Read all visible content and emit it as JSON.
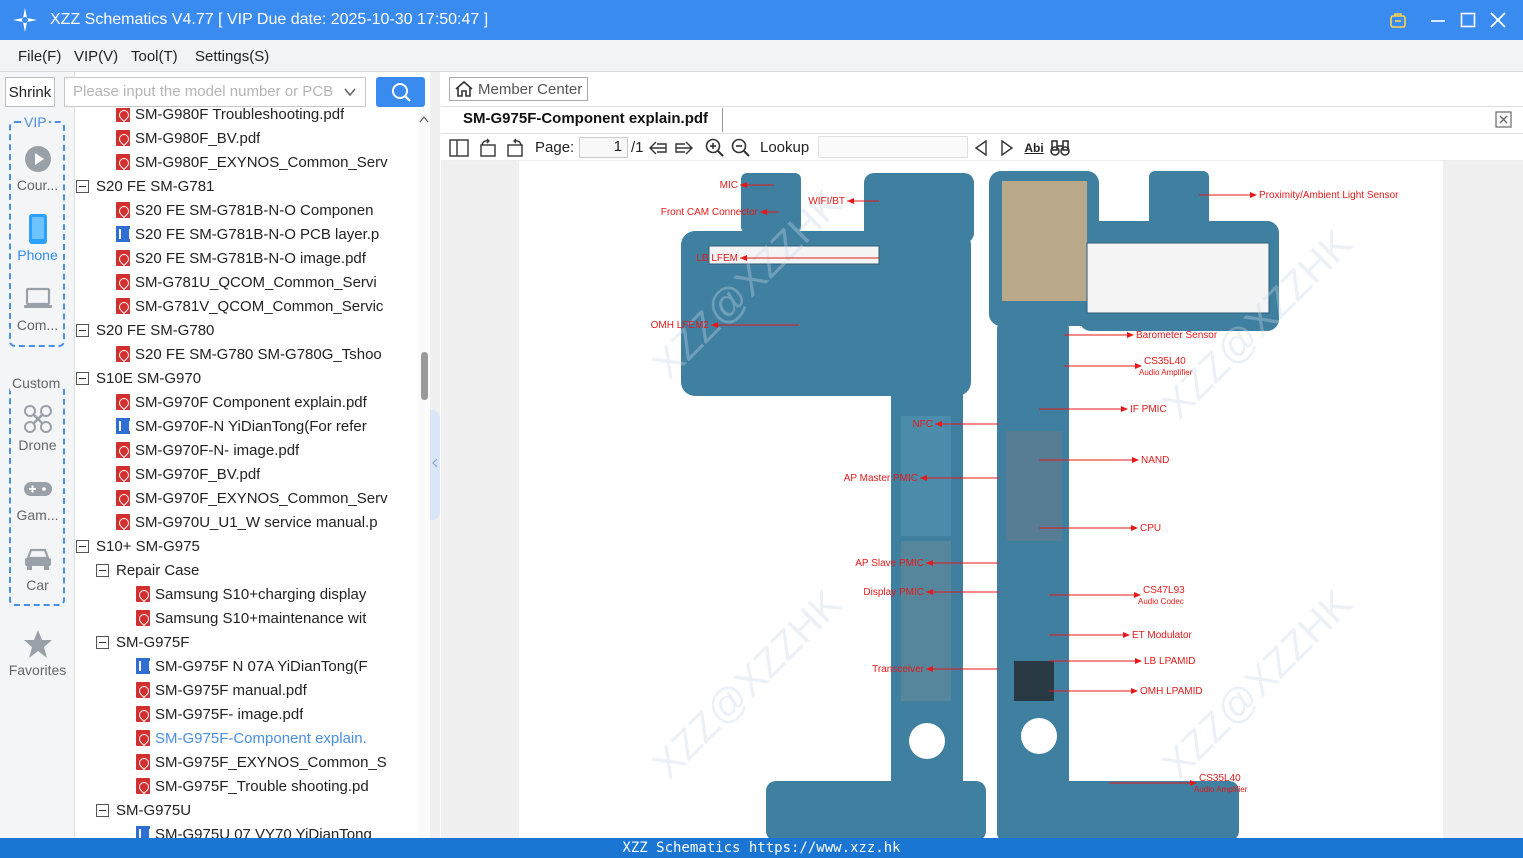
{
  "window": {
    "title": "XZZ Schematics V4.77 [ VIP Due date: 2025-10-30 17:50:47 ]"
  },
  "menu": [
    "File(F)",
    "VIP(V)",
    "Tool(T)",
    "Settings(S)"
  ],
  "search": {
    "shrink_label": "Shrink",
    "placeholder": "Please input the model number or PCB"
  },
  "nav": {
    "vip_label": "VIP",
    "custom_label": "Custom",
    "items": [
      {
        "label": "Cour...",
        "icon": "play-icon"
      },
      {
        "label": "Phone",
        "icon": "phone-icon"
      },
      {
        "label": "Com...",
        "icon": "laptop-icon"
      },
      {
        "label": "Drone",
        "icon": "drone-icon"
      },
      {
        "label": "Gam...",
        "icon": "gamepad-icon"
      },
      {
        "label": "Car",
        "icon": "car-icon"
      },
      {
        "label": "Favorites",
        "icon": "star-icon"
      }
    ]
  },
  "tree": [
    {
      "type": "pdf",
      "indent": 1,
      "label": "SM-G980F Troubleshooting.pdf"
    },
    {
      "type": "pdf",
      "indent": 1,
      "label": "SM-G980F_BV.pdf"
    },
    {
      "type": "pdf",
      "indent": 1,
      "label": "SM-G980F_EXYNOS_Common_Serv"
    },
    {
      "type": "folder",
      "indent": 0,
      "label": "S20 FE SM-G781"
    },
    {
      "type": "pdf",
      "indent": 1,
      "label": "S20 FE SM-G781B-N-O Componen"
    },
    {
      "type": "pcb",
      "indent": 1,
      "label": "S20 FE SM-G781B-N-O PCB layer.p"
    },
    {
      "type": "pdf",
      "indent": 1,
      "label": "S20 FE SM-G781B-N-O image.pdf"
    },
    {
      "type": "pdf",
      "indent": 1,
      "label": "SM-G781U_QCOM_Common_Servi"
    },
    {
      "type": "pdf",
      "indent": 1,
      "label": "SM-G781V_QCOM_Common_Servic"
    },
    {
      "type": "folder",
      "indent": 0,
      "label": "S20 FE SM-G780"
    },
    {
      "type": "pdf",
      "indent": 1,
      "label": "S20 FE SM-G780 SM-G780G_Tshoo"
    },
    {
      "type": "folder",
      "indent": 0,
      "label": "S10E SM-G970"
    },
    {
      "type": "pdf",
      "indent": 1,
      "label": "SM-G970F Component explain.pdf"
    },
    {
      "type": "pcb",
      "indent": 1,
      "label": "SM-G970F-N YiDianTong(For refer"
    },
    {
      "type": "pdf",
      "indent": 1,
      "label": "SM-G970F-N- image.pdf"
    },
    {
      "type": "pdf",
      "indent": 1,
      "label": "SM-G970F_BV.pdf"
    },
    {
      "type": "pdf",
      "indent": 1,
      "label": "SM-G970F_EXYNOS_Common_Serv"
    },
    {
      "type": "pdf",
      "indent": 1,
      "label": "SM-G970U_U1_W service manual.p"
    },
    {
      "type": "folder",
      "indent": 0,
      "label": "S10+ SM-G975"
    },
    {
      "type": "folder",
      "indent": 1,
      "label": "Repair Case"
    },
    {
      "type": "pdf",
      "indent": 2,
      "label": "Samsung S10+charging display"
    },
    {
      "type": "pdf",
      "indent": 2,
      "label": "Samsung S10+maintenance wit"
    },
    {
      "type": "folder",
      "indent": 1,
      "label": "SM-G975F"
    },
    {
      "type": "pcb",
      "indent": 2,
      "label": "SM-G975F N 07A YiDianTong(F"
    },
    {
      "type": "pdf",
      "indent": 2,
      "label": "SM-G975F manual.pdf"
    },
    {
      "type": "pdf",
      "indent": 2,
      "label": "SM-G975F- image.pdf"
    },
    {
      "type": "pdf",
      "indent": 2,
      "label": "SM-G975F-Component explain.",
      "selected": true
    },
    {
      "type": "pdf",
      "indent": 2,
      "label": "SM-G975F_EXYNOS_Common_S"
    },
    {
      "type": "pdf",
      "indent": 2,
      "label": "SM-G975F_Trouble shooting.pd"
    },
    {
      "type": "folder",
      "indent": 1,
      "label": "SM-G975U"
    },
    {
      "type": "pcb",
      "indent": 2,
      "label": "SM-G975U 07 VY70 YiDianTong"
    }
  ],
  "viewer": {
    "member_center": "Member Center",
    "tab_title": "SM-G975F-Component explain.pdf",
    "page_label": "Page:",
    "page_value": "1",
    "page_total": "/1",
    "lookup_label": "Lookup",
    "find_label": "Abi"
  },
  "diagram": {
    "left_labels": [
      "MIC",
      "WIFI/BT",
      "Front CAM Connector",
      "LB LFEM",
      "OMH LFEM2",
      "NFC",
      "AP Master PMIC",
      "AP Slave PMIC",
      "Display PMIC",
      "Transceiver"
    ],
    "right_labels": [
      "Proximity/Ambient Light Sensor",
      "Barometer Sensor",
      "CS35L40",
      "Audio Amplifier",
      "IF PMIC",
      "NAND",
      "CPU",
      "CS47L93",
      "Audio Codec",
      "ET Modulator",
      "LB LPAMID",
      "OMH LPAMID",
      "CS35L40",
      "Audio Amplifier"
    ],
    "watermark": "XZZ@XZZHK"
  },
  "status": "XZZ Schematics https://www.xzz.hk",
  "colors": {
    "accent": "#3a8bf0",
    "status_bar": "#1a76d2",
    "label_red": "#e41a1a",
    "pcb_blue": "#3f7fa0"
  }
}
